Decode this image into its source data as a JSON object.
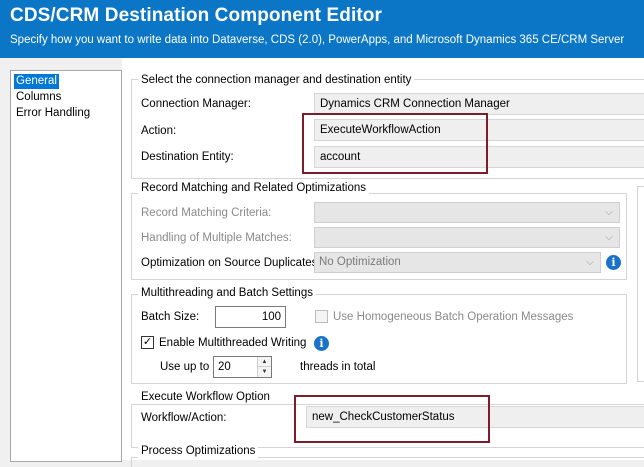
{
  "header": {
    "title": "CDS/CRM Destination Component Editor",
    "subtitle": "Specify how you want to write data into Dataverse, CDS (2.0), PowerApps, and Microsoft Dynamics 365 CE/CRM Server"
  },
  "nav": {
    "items": [
      {
        "label": "General",
        "selected": true
      },
      {
        "label": "Columns",
        "selected": false
      },
      {
        "label": "Error Handling",
        "selected": false
      }
    ]
  },
  "connection_group": {
    "legend": "Select the connection manager and destination entity",
    "connection_manager_label": "Connection Manager:",
    "connection_manager_value": "Dynamics CRM Connection Manager",
    "action_label": "Action:",
    "action_value": "ExecuteWorkflowAction",
    "destination_entity_label": "Destination Entity:",
    "destination_entity_value": "account"
  },
  "matching_group": {
    "legend": "Record Matching and Related Optimizations",
    "criteria_label": "Record Matching Criteria:",
    "criteria_value": "",
    "multiple_matches_label": "Handling of Multiple Matches:",
    "multiple_matches_value": "",
    "duplicates_label": "Optimization on Source Duplicates:",
    "duplicates_value": "No Optimization"
  },
  "threading_group": {
    "legend": "Multithreading and Batch Settings",
    "batch_size_label": "Batch Size:",
    "batch_size_value": "100",
    "homogeneous_label": "Use Homogeneous Batch Operation Messages",
    "homogeneous_checked": false,
    "multithreaded_label": "Enable Multithreaded Writing",
    "multithreaded_checked": true,
    "use_up_to_label": "Use up to",
    "threads_value": "20",
    "threads_suffix": "threads in total"
  },
  "workflow_group": {
    "legend": "Execute Workflow Option",
    "workflow_label": "Workflow/Action:",
    "workflow_value": "new_CheckCustomerStatus"
  },
  "process_group": {
    "legend": "Process Optimizations"
  },
  "glyphs": {
    "check": "✓",
    "info": "i",
    "dropdown": "⌵",
    "spin_up": "▲",
    "spin_down": "▼"
  },
  "colors": {
    "header_bg": "#0b76c6",
    "selection": "#0078d7",
    "highlight": "#7b1d2a",
    "info": "#1a73c9"
  }
}
